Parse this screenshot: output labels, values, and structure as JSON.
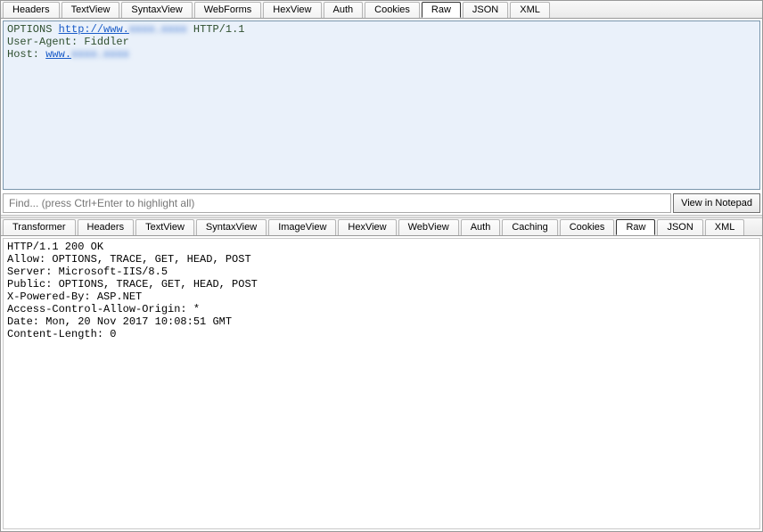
{
  "request": {
    "tabs": [
      "Headers",
      "TextView",
      "SyntaxView",
      "WebForms",
      "HexView",
      "Auth",
      "Cookies",
      "Raw",
      "JSON",
      "XML"
    ],
    "selected": "Raw",
    "raw": {
      "method": "OPTIONS",
      "url_scheme": "http://",
      "url_prefix": "www.",
      "url_blur": "xxxx.xxxx",
      "http_version": "HTTP/1.1",
      "user_agent_key": "User-Agent:",
      "user_agent_val": "Fiddler",
      "host_key": "Host:",
      "host_link_prefix": "www.",
      "host_link_blur": "xxxx.xxxx"
    }
  },
  "find": {
    "placeholder": "Find... (press Ctrl+Enter to highlight all)",
    "notepad_label": "View in Notepad"
  },
  "response": {
    "tabs": [
      "Transformer",
      "Headers",
      "TextView",
      "SyntaxView",
      "ImageView",
      "HexView",
      "WebView",
      "Auth",
      "Caching",
      "Cookies",
      "Raw",
      "JSON",
      "XML"
    ],
    "selected": "Raw",
    "lines": [
      "HTTP/1.1 200 OK",
      "Allow: OPTIONS, TRACE, GET, HEAD, POST",
      "Server: Microsoft-IIS/8.5",
      "Public: OPTIONS, TRACE, GET, HEAD, POST",
      "X-Powered-By: ASP.NET",
      "Access-Control-Allow-Origin: *",
      "Date: Mon, 20 Nov 2017 10:08:51 GMT",
      "Content-Length: 0"
    ]
  }
}
